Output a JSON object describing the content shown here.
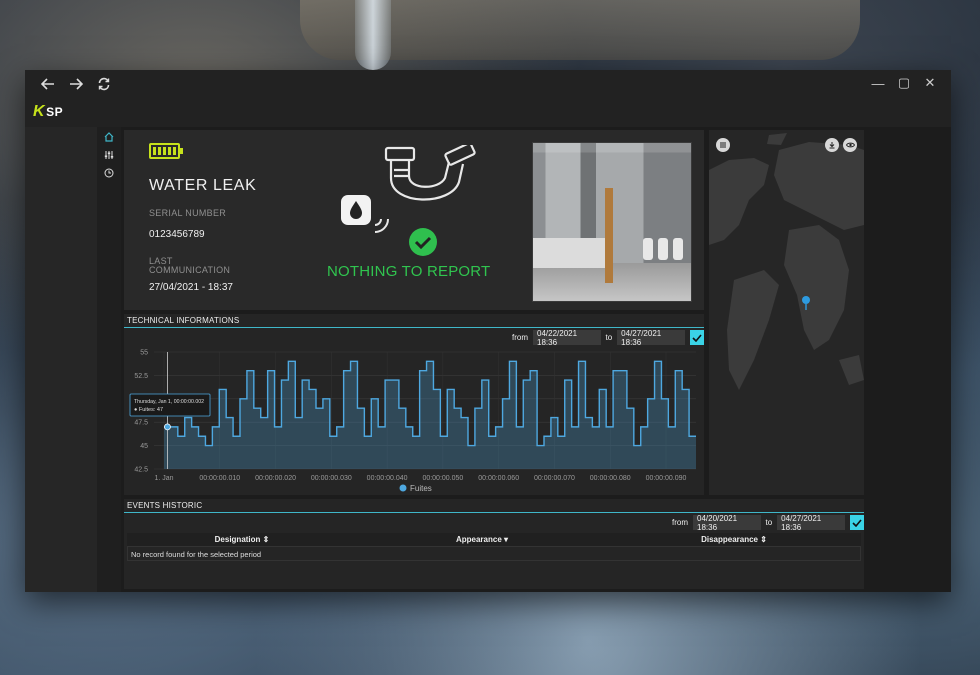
{
  "window": {
    "nav": {
      "back_icon": "arrow-left-icon",
      "forward_icon": "arrow-right-icon",
      "refresh_icon": "refresh-icon"
    },
    "controls": {
      "minimize": "—",
      "maximize": "▢",
      "close": "✕"
    }
  },
  "logo": {
    "k": "K",
    "rest": "SP"
  },
  "sidebar": {
    "items": [
      {
        "icon": "home-icon",
        "active": true
      },
      {
        "icon": "sliders-icon"
      },
      {
        "icon": "clock-icon"
      }
    ]
  },
  "device": {
    "battery_level": 1.0,
    "title": "WATER LEAK",
    "serial_label": "SERIAL NUMBER",
    "serial_value": "0123456789",
    "last_comm_label_1": "LAST",
    "last_comm_label_2": "COMMUNICATION",
    "last_comm_value": "27/04/2021 - 18:37",
    "status_text": "NOTHING TO REPORT",
    "status_color": "#30c54f",
    "accent_color": "#c6e21b"
  },
  "technical": {
    "heading": "TECHNICAL INFORMATIONS",
    "from_label": "from",
    "from_value": "04/22/2021 18:36",
    "to_label": "to",
    "to_value": "04/27/2021 18:36"
  },
  "chart_data": {
    "type": "area",
    "series": [
      {
        "name": "Fuites",
        "color": "#4ea8e0"
      }
    ],
    "yticks": [
      "42.5",
      "45",
      "47.5",
      "50",
      "52.5",
      "55"
    ],
    "ylim": [
      42.5,
      55
    ],
    "xticks": [
      "1. Jan",
      "00:00:00.010",
      "00:00:00.020",
      "00:00:00.030",
      "00:00:00.040",
      "00:00:00.050",
      "00:00:00.060",
      "00:00:00.070",
      "00:00:00.080",
      "00:00:00.090"
    ],
    "values": [
      47,
      47,
      46,
      48,
      47,
      46,
      45,
      47,
      51,
      48,
      46,
      50,
      53,
      49,
      48,
      53,
      47,
      52,
      54,
      48,
      52,
      51,
      49,
      50,
      46,
      47,
      53,
      54,
      49,
      46,
      50,
      47,
      52,
      52,
      49,
      47,
      46,
      53,
      54,
      51,
      46,
      51,
      49,
      48,
      45,
      49,
      52,
      46,
      47,
      50,
      54,
      47,
      52,
      53,
      45,
      46,
      48,
      46,
      52,
      47,
      54,
      48,
      47,
      51,
      47,
      53,
      53,
      49,
      45,
      47,
      50,
      54,
      50,
      47,
      53,
      51,
      46
    ],
    "tooltip": {
      "title": "Thursday, Jan 1, 00:00:00.002",
      "series": "Fuites",
      "value": "47"
    },
    "legend": "bottom-center"
  },
  "events": {
    "heading": "EVENTS HISTORIC",
    "from_label": "from",
    "from_value": "04/20/2021 18:36",
    "to_label": "to",
    "to_value": "04/27/2021 18:36",
    "columns": [
      "Designation ⇕",
      "Appearance ▾",
      "Disappearance ⇕"
    ],
    "empty_text": "No record found for the selected period"
  }
}
